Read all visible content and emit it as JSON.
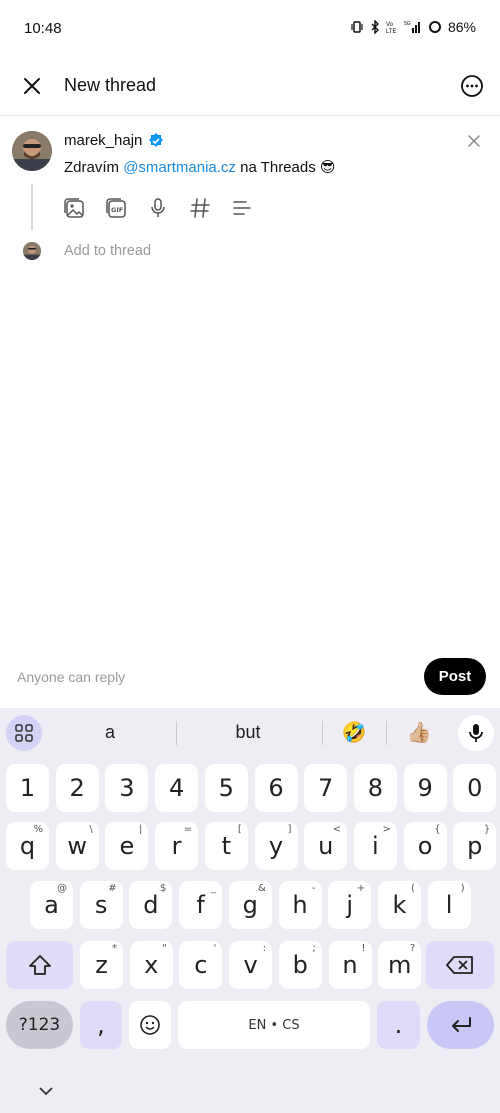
{
  "status_bar": {
    "time": "10:48",
    "battery": "86%"
  },
  "header": {
    "title": "New thread"
  },
  "post": {
    "username": "marek_hajn",
    "text_before": "Zdravím ",
    "mention": "@smartmania.cz",
    "text_after": " na Threads 😎"
  },
  "add_thread": {
    "placeholder": "Add to thread"
  },
  "footer": {
    "reply_setting": "Anyone can reply",
    "post_label": "Post"
  },
  "keyboard": {
    "suggestions": [
      "a",
      "but",
      "🤣",
      "👍🏼"
    ],
    "row_numbers": [
      "1",
      "2",
      "3",
      "4",
      "5",
      "6",
      "7",
      "8",
      "9",
      "0"
    ],
    "row1": [
      {
        "k": "q",
        "s": "%"
      },
      {
        "k": "w",
        "s": "\\"
      },
      {
        "k": "e",
        "s": "|"
      },
      {
        "k": "r",
        "s": "="
      },
      {
        "k": "t",
        "s": "["
      },
      {
        "k": "y",
        "s": "]"
      },
      {
        "k": "u",
        "s": "<"
      },
      {
        "k": "i",
        "s": ">"
      },
      {
        "k": "o",
        "s": "{"
      },
      {
        "k": "p",
        "s": "}"
      }
    ],
    "row2": [
      {
        "k": "a",
        "s": "@"
      },
      {
        "k": "s",
        "s": "#"
      },
      {
        "k": "d",
        "s": "$"
      },
      {
        "k": "f",
        "s": "_"
      },
      {
        "k": "g",
        "s": "&"
      },
      {
        "k": "h",
        "s": "-"
      },
      {
        "k": "j",
        "s": "+"
      },
      {
        "k": "k",
        "s": "("
      },
      {
        "k": "l",
        "s": ")"
      }
    ],
    "row3": [
      {
        "k": "z",
        "s": "*"
      },
      {
        "k": "x",
        "s": "\""
      },
      {
        "k": "c",
        "s": "'"
      },
      {
        "k": "v",
        "s": ":"
      },
      {
        "k": "b",
        "s": ";"
      },
      {
        "k": "n",
        "s": "!"
      },
      {
        "k": "m",
        "s": "?"
      }
    ],
    "symbols_label": "?123",
    "comma": ",",
    "space_label": "EN • CS",
    "period": "."
  }
}
